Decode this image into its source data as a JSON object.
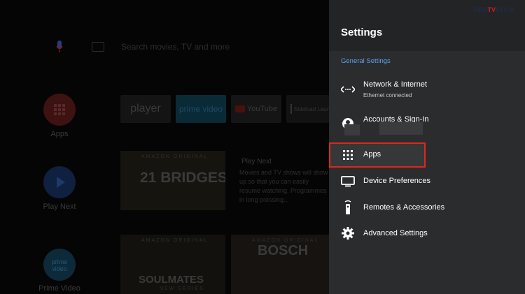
{
  "home": {
    "search_placeholder": "Search movies, TV and more",
    "sidebar": [
      {
        "label": "Apps",
        "icon": "apps-grid-icon"
      },
      {
        "label": "Play Next",
        "icon": "play-icon"
      },
      {
        "label": "Prime Video",
        "icon": "prime-video-icon"
      }
    ],
    "app_row": [
      {
        "label": "player",
        "icon": "player-icon"
      },
      {
        "label": "prime video",
        "icon": "prime-video-icon"
      },
      {
        "label": "YouTube",
        "icon": "youtube-icon"
      },
      {
        "label": "Sideload Launcher",
        "icon": "sideload-launcher-icon"
      }
    ],
    "posters": [
      {
        "tag": "AMAZON ORIGINAL",
        "title": "21 BRIDGES",
        "subtitle": ""
      },
      {
        "tag": "AMAZON ORIGINAL",
        "title": "SOULMATES",
        "subtitle": "NEW SERIES"
      },
      {
        "tag": "AMAZON ORIGINAL",
        "title": "BOSCH",
        "subtitle": ""
      }
    ],
    "play_next": {
      "title": "Play Next",
      "body": "Movies and TV shows will show up so that you can easily resume watching. Programmes in long pressing..."
    }
  },
  "panel": {
    "logo_prefix": "FIRE",
    "logo_tv": "TV",
    "logo_suffix": "STICK",
    "title": "Settings",
    "section_label": "General Settings",
    "items": [
      {
        "label": "Network & Internet",
        "sub": "Ethernet connected",
        "icon": "network-arrows-icon"
      },
      {
        "label": "Accounts & Sign-In",
        "sub": "",
        "icon": "account-icon"
      },
      {
        "label": "Apps",
        "sub": "",
        "icon": "apps-grid-icon"
      },
      {
        "label": "Device Preferences",
        "sub": "",
        "icon": "tv-display-icon"
      },
      {
        "label": "Remotes & Accessories",
        "sub": "",
        "icon": "remote-icon"
      },
      {
        "label": "Advanced Settings",
        "sub": "",
        "icon": "gear-icon"
      }
    ],
    "highlight_color": "#e0261c",
    "accent_color": "#5aa6f0"
  }
}
